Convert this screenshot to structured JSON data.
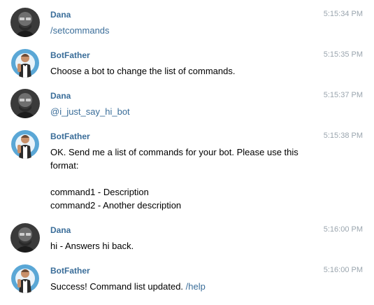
{
  "messages": [
    {
      "sender": "Dana",
      "time": "5:15:34 PM",
      "avatar": "dana-avatar-icon",
      "lines": [
        {
          "link": "/setcommands"
        }
      ]
    },
    {
      "sender": "BotFather",
      "time": "5:15:35 PM",
      "avatar": "botfather-avatar-icon",
      "lines": [
        {
          "text": "Choose a bot to change the list of commands."
        }
      ]
    },
    {
      "sender": "Dana",
      "time": "5:15:37 PM",
      "avatar": "dana-avatar-icon",
      "lines": [
        {
          "link": "@i_just_say_hi_bot"
        }
      ]
    },
    {
      "sender": "BotFather",
      "time": "5:15:38 PM",
      "avatar": "botfather-avatar-icon",
      "lines": [
        {
          "text": "OK. Send me a list of commands for your bot. Please use this"
        },
        {
          "text": "format:"
        },
        {
          "text": ""
        },
        {
          "text": "command1 - Description"
        },
        {
          "text": "command2 - Another description"
        }
      ]
    },
    {
      "sender": "Dana",
      "time": "5:16:00 PM",
      "avatar": "dana-avatar-icon",
      "lines": [
        {
          "text": "hi - Answers hi back."
        }
      ]
    },
    {
      "sender": "BotFather",
      "time": "5:16:00 PM",
      "avatar": "botfather-avatar-icon",
      "lines": [
        {
          "text": "Success! Command list updated. ",
          "link": "/help"
        }
      ]
    }
  ],
  "colors": {
    "sender": "#3a6d99",
    "link": "#3a6d99",
    "time": "#9aa5ae",
    "text": "#000000"
  }
}
